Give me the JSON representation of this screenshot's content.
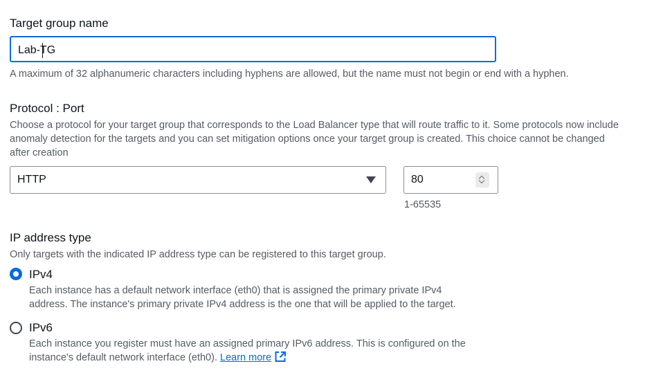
{
  "target_group": {
    "label": "Target group name",
    "value": "Lab-TG",
    "hint": "A maximum of 32 alphanumeric characters including hyphens are allowed, but the name must not begin or end with a hyphen."
  },
  "protocol_port": {
    "label": "Protocol : Port",
    "description_lines": [
      "Choose a protocol for your target group that corresponds to the Load Balancer type that will route traffic to it. Some protocols now include",
      "anomaly detection for the targets and you can set mitigation options once your target group is created. This choice cannot be changed",
      "after creation"
    ],
    "protocol_value": "HTTP",
    "port_value": "80",
    "port_hint": "1-65535"
  },
  "ip_address_type": {
    "label": "IP address type",
    "description": "Only targets with the indicated IP address type can be registered to this target group.",
    "options": [
      {
        "label": "IPv4",
        "selected": true,
        "description_lines": [
          "Each instance has a default network interface (eth0) that is assigned the primary private IPv4",
          "address. The instance's primary private IPv4 address is the one that will be applied to the target."
        ]
      },
      {
        "label": "IPv6",
        "selected": false,
        "description_lines": [
          "Each instance you register must have an assigned primary IPv6 address. This is configured on the",
          "instance's default network interface (eth0)."
        ],
        "link_text": "Learn more"
      }
    ]
  },
  "colors": {
    "accent": "#006ce0",
    "text": "#0f141a",
    "secondary_text": "#545b64",
    "border": "#8c8c94"
  },
  "icons": {
    "select_caret": "caret-down-icon",
    "external_link": "external-link-icon",
    "spinner": "spinner-icon"
  }
}
